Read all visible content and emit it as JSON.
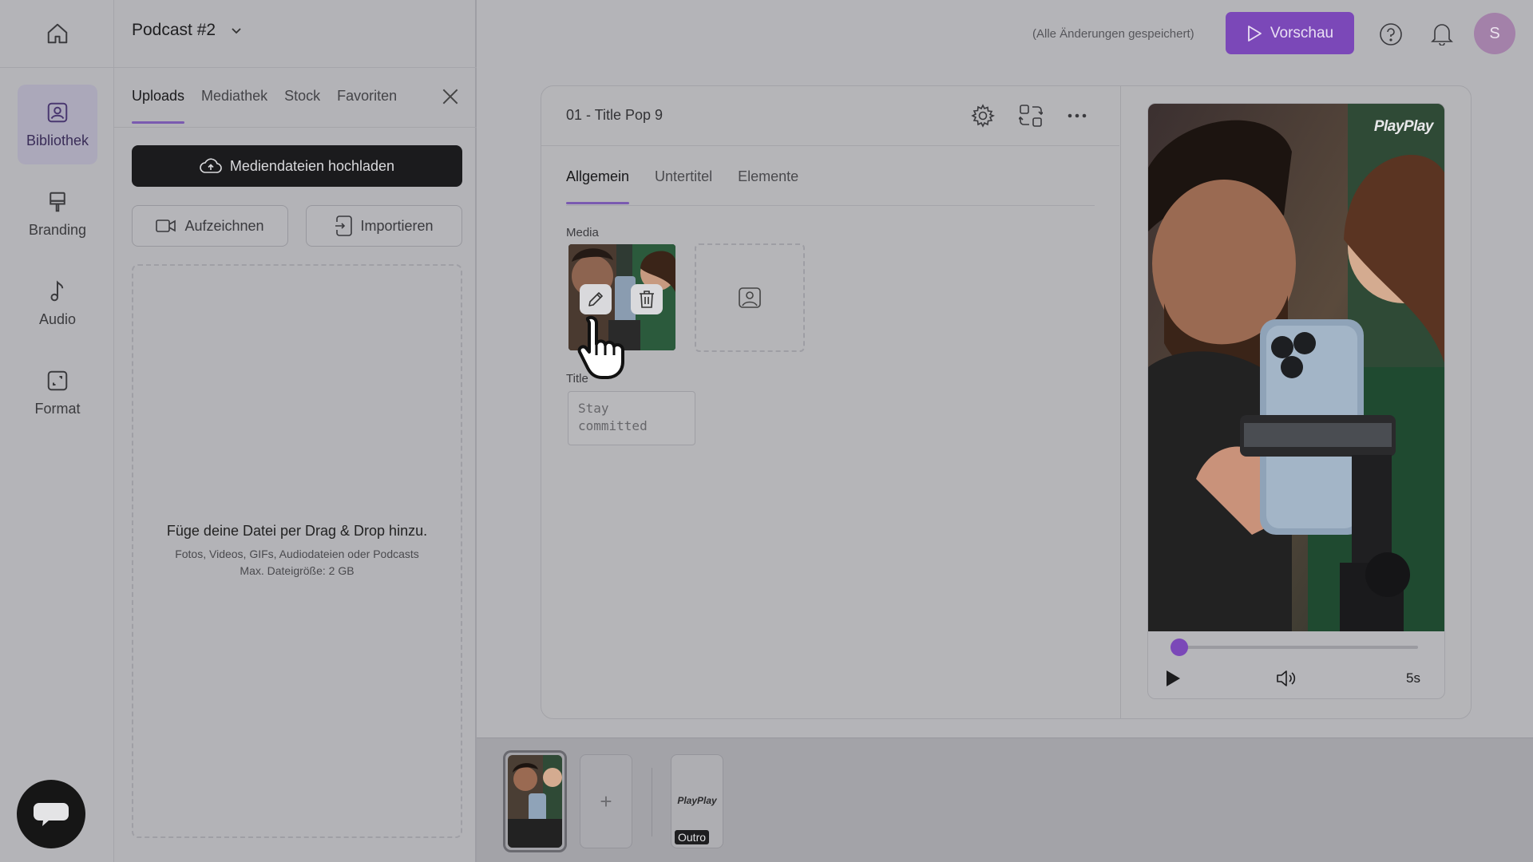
{
  "rail": {
    "items": [
      {
        "label": "Bibliothek",
        "icon": "library-icon",
        "active": true
      },
      {
        "label": "Branding",
        "icon": "brush-icon",
        "active": false
      },
      {
        "label": "Audio",
        "icon": "music-note-icon",
        "active": false
      },
      {
        "label": "Format",
        "icon": "resize-icon",
        "active": false
      }
    ]
  },
  "library": {
    "project_name": "Podcast #2",
    "tabs": [
      "Uploads",
      "Mediathek",
      "Stock",
      "Favoriten"
    ],
    "active_tab": "Uploads",
    "upload_button": "Mediendateien hochladen",
    "record_button": "Aufzeichnen",
    "import_button": "Importieren",
    "drop_title": "Füge deine Datei per Drag & Drop hinzu.",
    "drop_line1": "Fotos, Videos, GIFs, Audiodateien oder Podcasts",
    "drop_line2": "Max. Dateigröße: 2 GB"
  },
  "topbar": {
    "saved_status": "(Alle Änderungen gespeichert)",
    "preview_button": "Vorschau",
    "avatar_initial": "S",
    "accent": "#7b48b8"
  },
  "editor": {
    "scene_title": "01 - Title Pop 9",
    "tabs": [
      "Allgemein",
      "Untertitel",
      "Elemente"
    ],
    "active_tab": "Allgemein",
    "media_label": "Media",
    "title_label": "Title",
    "title_value": "Stay committed"
  },
  "player": {
    "brand": "PlayPlay",
    "duration": "5s",
    "progress": 0.0
  },
  "timeline": {
    "add_label": "+",
    "outro_logo": "PlayPlay",
    "outro_label": "Outro"
  }
}
